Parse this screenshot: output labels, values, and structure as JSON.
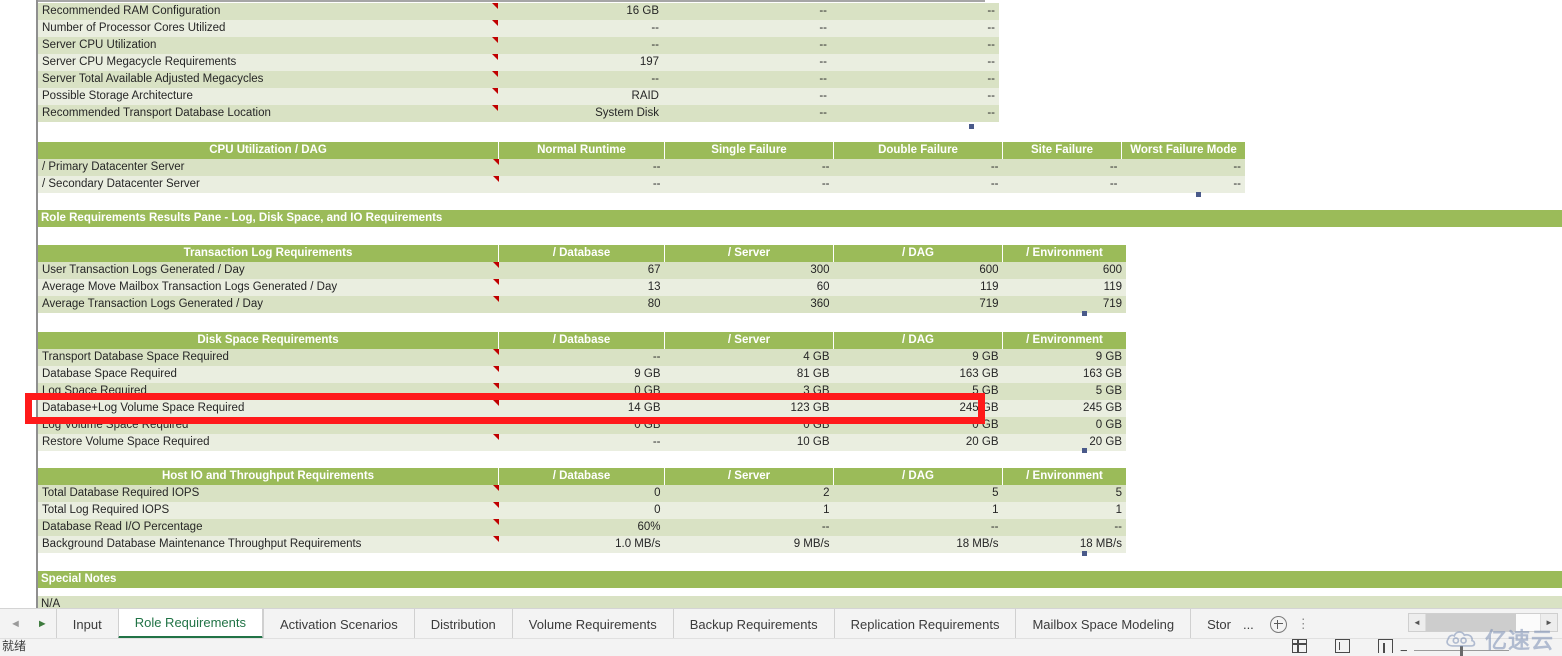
{
  "app": {
    "type": "spreadsheet",
    "status_text": "就绪",
    "colors": {
      "header_green": "#9bbb59",
      "band_dark": "#d9e2c4",
      "band_light": "#eaeee0",
      "highlight_red": "#ff1a1a",
      "active_tab_green": "#217346"
    }
  },
  "top_section": {
    "rows": [
      {
        "label": "Recommended RAM Configuration",
        "v1": "16 GB",
        "v2": "--",
        "v3": "--"
      },
      {
        "label": "Number of Processor Cores Utilized",
        "v1": "--",
        "v2": "--",
        "v3": "--"
      },
      {
        "label": "Server CPU Utilization",
        "v1": "--",
        "v2": "--",
        "v3": "--"
      },
      {
        "label": "Server CPU Megacycle Requirements",
        "v1": "197",
        "v2": "--",
        "v3": "--"
      },
      {
        "label": "Server Total Available Adjusted Megacycles",
        "v1": "--",
        "v2": "--",
        "v3": "--"
      },
      {
        "label": "Possible Storage Architecture",
        "v1": "RAID",
        "v2": "--",
        "v3": "--"
      },
      {
        "label": "Recommended Transport Database Location",
        "v1": "System Disk",
        "v2": "--",
        "v3": "--"
      }
    ]
  },
  "cpu_dag_section": {
    "headers": [
      "CPU Utilization / DAG",
      "Normal Runtime",
      "Single Failure",
      "Double Failure",
      "Site Failure",
      "Worst Failure Mode"
    ],
    "rows": [
      {
        "label": "/ Primary Datacenter Server",
        "values": [
          "--",
          "--",
          "--",
          "--",
          "--"
        ]
      },
      {
        "label": "/ Secondary Datacenter Server",
        "values": [
          "--",
          "--",
          "--",
          "--",
          "--"
        ]
      }
    ]
  },
  "pane_title": "Role Requirements Results Pane  - Log, Disk Space, and IO Requirements",
  "transaction_log_section": {
    "headers": [
      "Transaction Log Requirements",
      "/ Database",
      "/ Server",
      "/ DAG",
      "/ Environment"
    ],
    "rows": [
      {
        "label": "User Transaction Logs Generated / Day",
        "values": [
          "67",
          "300",
          "600",
          "600"
        ]
      },
      {
        "label": "Average Move Mailbox Transaction Logs Generated / Day",
        "values": [
          "13",
          "60",
          "119",
          "119"
        ]
      },
      {
        "label": "Average Transaction Logs Generated / Day",
        "values": [
          "80",
          "360",
          "719",
          "719"
        ]
      }
    ]
  },
  "disk_space_section": {
    "headers": [
      "Disk Space Requirements",
      "/ Database",
      "/ Server",
      "/ DAG",
      "/ Environment"
    ],
    "rows": [
      {
        "label": "Transport Database Space Required",
        "values": [
          "--",
          "4 GB",
          "9 GB",
          "9 GB"
        ]
      },
      {
        "label": "Database Space Required",
        "values": [
          "9 GB",
          "81 GB",
          "163 GB",
          "163 GB"
        ]
      },
      {
        "label": "Log Space Required",
        "values": [
          "0 GB",
          "3 GB",
          "5 GB",
          "5 GB"
        ]
      },
      {
        "label": "Database+Log Volume Space Required",
        "values": [
          "14 GB",
          "123 GB",
          "245 GB",
          "245 GB"
        ],
        "highlighted": true
      },
      {
        "label": "Log Volume Space Required",
        "values": [
          "0 GB",
          "0 GB",
          "0 GB",
          "0 GB"
        ]
      },
      {
        "label": "Restore Volume Space Required",
        "values": [
          "--",
          "10 GB",
          "20 GB",
          "20 GB"
        ]
      }
    ]
  },
  "host_io_section": {
    "headers": [
      "Host IO and Throughput Requirements",
      "/ Database",
      "/ Server",
      "/ DAG",
      "/ Environment"
    ],
    "rows": [
      {
        "label": "Total Database Required IOPS",
        "values": [
          "0",
          "2",
          "5",
          "5"
        ]
      },
      {
        "label": "Total Log Required IOPS",
        "values": [
          "0",
          "1",
          "1",
          "1"
        ]
      },
      {
        "label": "Database Read I/O Percentage",
        "values": [
          "60%",
          "--",
          "--",
          "--"
        ]
      },
      {
        "label": "Background Database Maintenance Throughput Requirements",
        "values": [
          "1.0 MB/s",
          "9 MB/s",
          "18 MB/s",
          "18 MB/s"
        ]
      }
    ]
  },
  "special_notes": {
    "title": "Special Notes",
    "body": "N/A"
  },
  "sheet_tabs": {
    "nav_prev": "◄",
    "nav_next": "►",
    "items": [
      {
        "label": "Input",
        "active": false
      },
      {
        "label": "Role Requirements",
        "active": true
      },
      {
        "label": "Activation Scenarios",
        "active": false
      },
      {
        "label": "Distribution",
        "active": false
      },
      {
        "label": "Volume Requirements",
        "active": false
      },
      {
        "label": "Backup Requirements",
        "active": false
      },
      {
        "label": "Replication Requirements",
        "active": false
      },
      {
        "label": "Mailbox Space Modeling",
        "active": false
      },
      {
        "label": "Stor",
        "active": false
      }
    ],
    "overflow": "...",
    "add_label": "+",
    "more_dots": "⋮"
  },
  "watermark": {
    "text": "亿速云"
  }
}
